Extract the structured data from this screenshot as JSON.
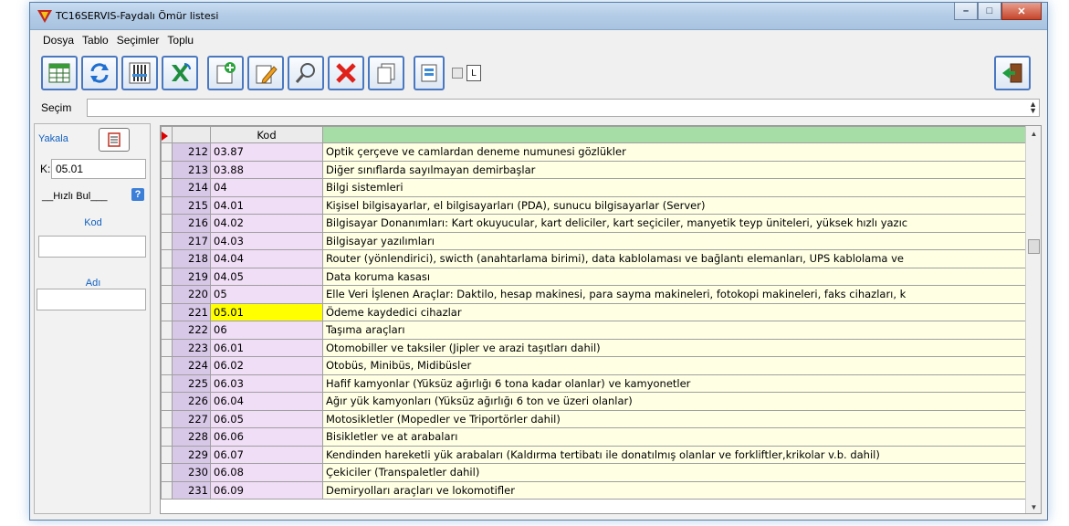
{
  "window": {
    "title": "TC16SERVIS-Faydalı Ömür listesi"
  },
  "menu": [
    "Dosya",
    "Tablo",
    "Seçimler",
    "Toplu"
  ],
  "toolbar": {
    "buttons": [
      "table-grid-icon",
      "refresh-icon",
      "columns-icon",
      "excel-icon",
      "new-document-icon",
      "edit-pencil-icon",
      "search-magnifier-icon",
      "delete-x-icon",
      "copy-document-icon",
      "scroll-icon"
    ],
    "l_label": "L"
  },
  "secim": {
    "label": "Seçim",
    "value": ""
  },
  "left": {
    "yakala": "Yakala",
    "k_label": "K:",
    "k_value": "05.01",
    "hizli_bul": "__Hızlı Bul___",
    "kod_label": "Kod",
    "kod_value": "",
    "adi_label": "Adı",
    "adi_value": ""
  },
  "table": {
    "headers": {
      "num": "",
      "kod": "Kod",
      "desc": ""
    },
    "rows": [
      {
        "num": "212",
        "kod": "03.87",
        "desc": "Optik çerçeve ve camlardan deneme numunesi gözlükler"
      },
      {
        "num": "213",
        "kod": "03.88",
        "desc": "Diğer sınıflarda sayılmayan demirbaşlar"
      },
      {
        "num": "214",
        "kod": "04",
        "desc": "Bilgi sistemleri"
      },
      {
        "num": "215",
        "kod": "04.01",
        "desc": "Kişisel bilgisayarlar, el bilgisayarları (PDA), sunucu bilgisayarlar (Server)"
      },
      {
        "num": "216",
        "kod": "04.02",
        "desc": "Bilgisayar Donanımları: Kart okuyucular, kart deliciler, kart seçiciler, manyetik teyp üniteleri, yüksek hızlı yazıc"
      },
      {
        "num": "217",
        "kod": "04.03",
        "desc": "Bilgisayar yazılımları"
      },
      {
        "num": "218",
        "kod": "04.04",
        "desc": "Router (yönlendirici), swicth (anahtarlama birimi), data kablolaması ve bağlantı elemanları, UPS kablolama ve"
      },
      {
        "num": "219",
        "kod": "04.05",
        "desc": "Data koruma kasası"
      },
      {
        "num": "220",
        "kod": "05",
        "desc": "Elle Veri İşlenen Araçlar: Daktilo, hesap makinesi, para sayma makineleri, fotokopi makineleri, faks cihazları, k"
      },
      {
        "num": "221",
        "kod": "05.01",
        "desc": "Ödeme kaydedici cihazlar",
        "selected": true
      },
      {
        "num": "222",
        "kod": "06",
        "desc": "Taşıma araçları"
      },
      {
        "num": "223",
        "kod": "06.01",
        "desc": "Otomobiller ve taksiler (Jipler ve arazi taşıtları dahil)"
      },
      {
        "num": "224",
        "kod": "06.02",
        "desc": "Otobüs, Minibüs, Midibüsler"
      },
      {
        "num": "225",
        "kod": "06.03",
        "desc": "Hafif kamyonlar (Yüksüz ağırlığı 6 tona kadar olanlar) ve kamyonetler"
      },
      {
        "num": "226",
        "kod": "06.04",
        "desc": "Ağır yük kamyonları (Yüksüz ağırlığı 6 ton ve üzeri olanlar)"
      },
      {
        "num": "227",
        "kod": "06.05",
        "desc": "Motosikletler (Mopedler ve Triportörler dahil)"
      },
      {
        "num": "228",
        "kod": "06.06",
        "desc": "Bisikletler ve at arabaları"
      },
      {
        "num": "229",
        "kod": "06.07",
        "desc": "Kendinden hareketli yük arabaları (Kaldırma tertibatı ile donatılmış olanlar ve forkliftler,krikolar v.b. dahil)"
      },
      {
        "num": "230",
        "kod": "06.08",
        "desc": "Çekiciler (Transpaletler dahil)"
      },
      {
        "num": "231",
        "kod": "06.09",
        "desc": "Demiryolları araçları ve lokomotifler"
      }
    ]
  }
}
